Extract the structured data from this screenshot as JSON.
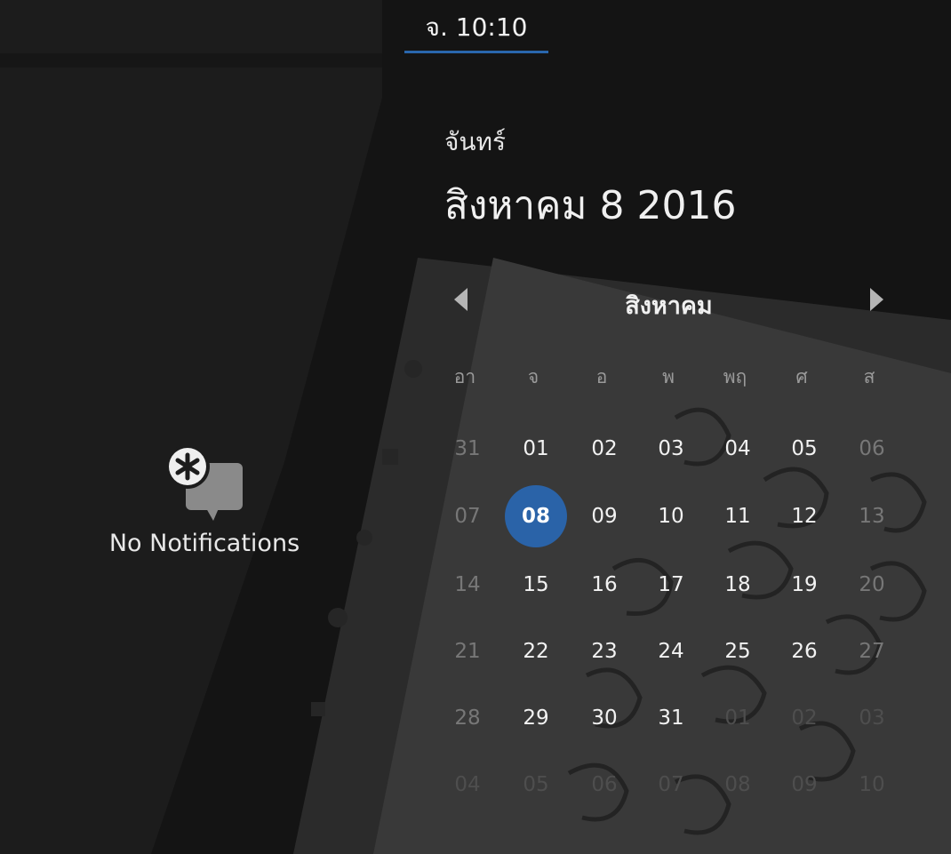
{
  "topbar": {
    "clock": "จ. 10:10"
  },
  "notifications": {
    "label": "No Notifications",
    "icon": "notification-bubble-asterisk-icon"
  },
  "header": {
    "day_name": "จันทร์",
    "full_date": "สิงหาคม  8 2016"
  },
  "calendar": {
    "month_label": "สิงหาคม",
    "prev_icon": "triangle-left-icon",
    "next_icon": "triangle-right-icon",
    "weekdays": [
      "อา",
      "จ",
      "อ",
      "พ",
      "พฤ",
      "ศ",
      "ส"
    ],
    "rows": [
      [
        "31",
        "01",
        "02",
        "03",
        "04",
        "05",
        "06"
      ],
      [
        "07",
        "08",
        "09",
        "10",
        "11",
        "12",
        "13"
      ],
      [
        "14",
        "15",
        "16",
        "17",
        "18",
        "19",
        "20"
      ],
      [
        "21",
        "22",
        "23",
        "24",
        "25",
        "26",
        "27"
      ],
      [
        "28",
        "29",
        "30",
        "31",
        "01",
        "02",
        "03"
      ],
      [
        "04",
        "05",
        "06",
        "07",
        "08",
        "09",
        "10"
      ]
    ],
    "selected_day": "08",
    "accent_color": "#2a63a8"
  }
}
